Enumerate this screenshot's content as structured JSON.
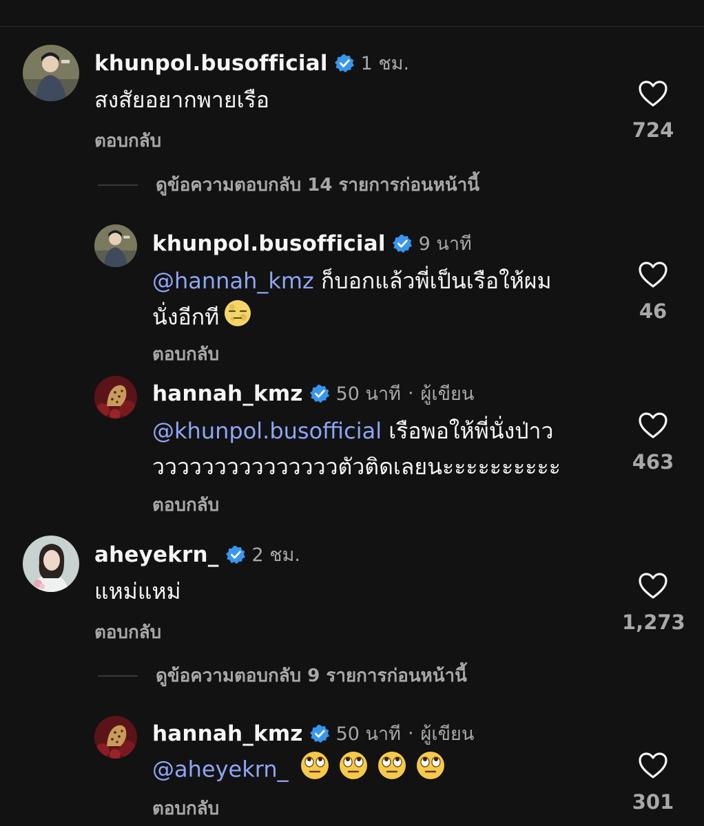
{
  "colors": {
    "background": "#121212",
    "text": "#f5f5f5",
    "secondary": "#a8a8a8",
    "mention": "#8ea6f5",
    "verified": "#3797f0"
  },
  "comments": [
    {
      "username": "khunpol.busofficial",
      "verified": true,
      "time": "1 ชม.",
      "text": "สงสัยอยากพายเรือ",
      "reply_label": "ตอบกลับ",
      "likes": "724"
    },
    {
      "view_replies": "ดูข้อความตอบกลับ 14 รายการก่อนหน้านี้"
    },
    {
      "username": "khunpol.busofficial",
      "verified": true,
      "time": "9 นาที",
      "mention": "@hannah_kmz",
      "text_line1": " ก็บอกแล้วพี่เป็นเรือให้ผม",
      "text_line2": "นั่งอีกที",
      "reply_label": "ตอบกลับ",
      "likes": "46"
    },
    {
      "username": "hannah_kmz",
      "verified": true,
      "time": "50 นาที",
      "separator": "·",
      "author_tag": "ผู้เขียน",
      "mention": "@khunpol.busofficial",
      "text_line1": " เรือพอให้พี่นั่งป่าว",
      "text_line2": "วววววววววววววววตัวติดเลยนะะะะะะะะะะ",
      "reply_label": "ตอบกลับ",
      "likes": "463"
    },
    {
      "username": "aheyekrn_",
      "verified": true,
      "time": "2 ชม.",
      "text": "แหม่แหม่",
      "reply_label": "ตอบกลับ",
      "likes": "1,273"
    },
    {
      "view_replies": "ดูข้อความตอบกลับ 9 รายการก่อนหน้านี้"
    },
    {
      "username": "hannah_kmz",
      "verified": true,
      "time": "50 นาที",
      "separator": "·",
      "author_tag": "ผู้เขียน",
      "mention": "@aheyekrn_",
      "reply_label": "ตอบกลับ",
      "likes": "301"
    }
  ]
}
